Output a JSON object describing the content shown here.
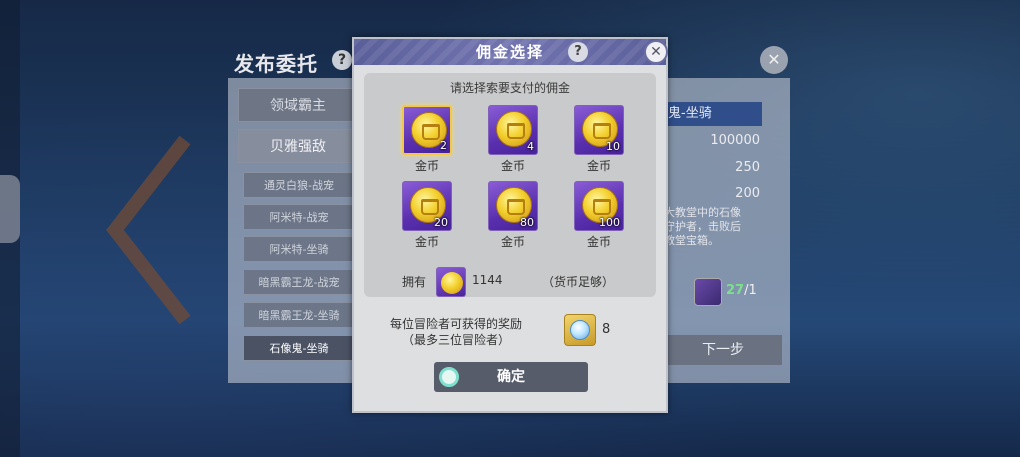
{
  "background": {
    "title": "发布委托",
    "categories": [
      "领域霸主",
      "贝雅强敌"
    ],
    "sub_items": [
      "通灵白狼-战宠",
      "阿米特-战宠",
      "阿米特-坐骑",
      "暗黑霸王龙-战宠",
      "暗黑霸王龙-坐骑",
      "石像鬼-坐骑"
    ],
    "selected_sub_item": "石像鬼-坐骑",
    "detail_header": "鬼-坐骑",
    "detail_values": [
      "100000",
      "250",
      "200"
    ],
    "detail_desc": [
      "大教堂中的石像",
      "守护者，击败后",
      "教堂宝箱。"
    ],
    "count_current": "27",
    "count_total": "/1",
    "next_button": "下一步"
  },
  "dialog": {
    "title": "佣金选择",
    "help_icon": "?",
    "prompt": "请选择索要支付的佣金",
    "options": [
      {
        "amount": "2",
        "label": "金币",
        "selected": true
      },
      {
        "amount": "4",
        "label": "金币",
        "selected": false
      },
      {
        "amount": "10",
        "label": "金币",
        "selected": false
      },
      {
        "amount": "20",
        "label": "金币",
        "selected": false
      },
      {
        "amount": "80",
        "label": "金币",
        "selected": false
      },
      {
        "amount": "100",
        "label": "金币",
        "selected": false
      }
    ],
    "own_label": "拥有",
    "own_amount": "1144",
    "own_status": "（货币足够）",
    "reward_line1": "每位冒险者可获得的奖励",
    "reward_line2": "（最多三位冒险者）",
    "reward_count": "8",
    "confirm": "确定"
  },
  "colors": {
    "header": "#6a6ea8",
    "coin_box": "#6a3cc0",
    "selected_border": "#f2c84a",
    "confirm_bg": "#575c6a"
  }
}
